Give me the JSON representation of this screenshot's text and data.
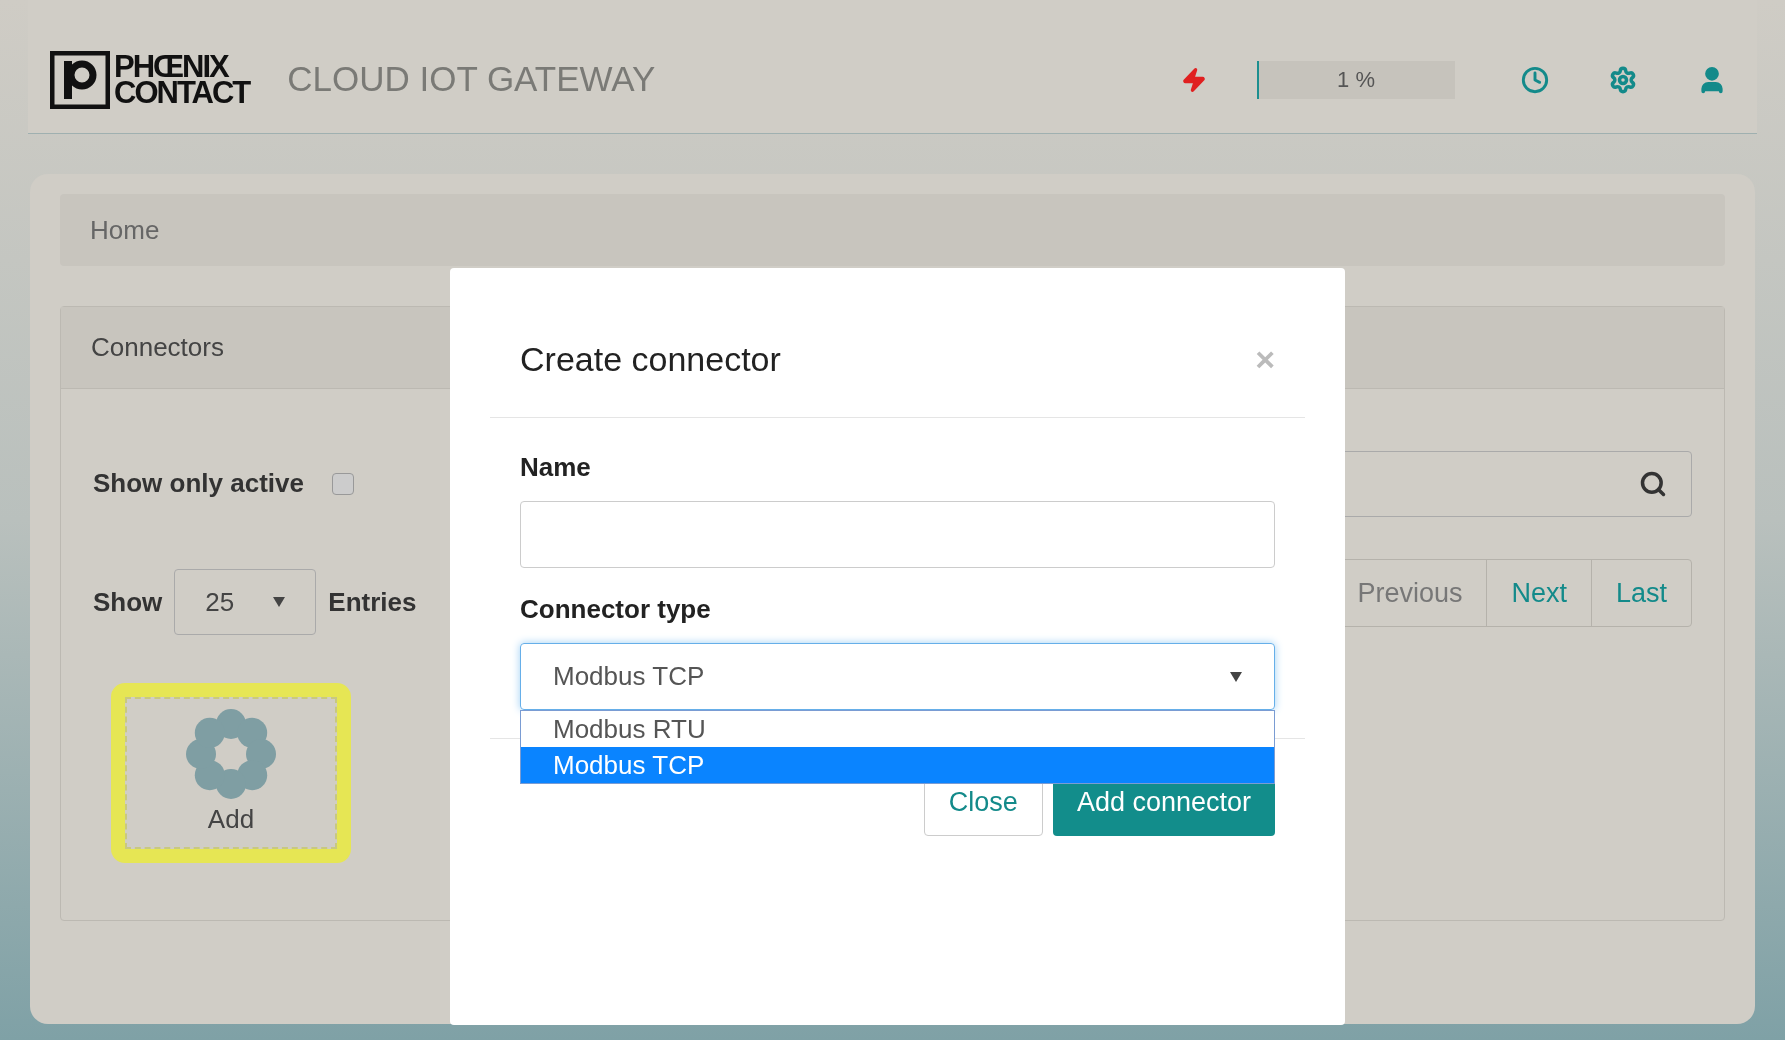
{
  "header": {
    "logo": [
      "PHŒNIX",
      "CONTACT"
    ],
    "title": "CLOUD IOT GATEWAY",
    "usage": {
      "level": 0.01,
      "reading": "1 %"
    }
  },
  "breadcrumb": "Home",
  "panel": {
    "title": "Connectors",
    "filter": {
      "label": "Show only active",
      "checked": false
    },
    "page_size": {
      "label_before": "Show",
      "value": "25",
      "label_after": "Entries"
    },
    "add_tile": {
      "label": "Add",
      "highlighted": true
    },
    "pagination": [
      {
        "label": "Previous",
        "disabled": true
      },
      {
        "label": "Next",
        "disabled": false
      },
      {
        "label": "Last",
        "disabled": false
      }
    ]
  },
  "modal": {
    "title": "Create connector",
    "close": "×",
    "fields": [
      {
        "label": "Name",
        "kind": "text"
      },
      {
        "label": "Connector type",
        "kind": "select",
        "value": "Modbus TCP",
        "open": true,
        "options": [
          {
            "label": "Modbus RTU",
            "selected": false
          },
          {
            "label": "Modbus TCP",
            "selected": true
          }
        ]
      }
    ],
    "buttons": [
      {
        "label": "Close",
        "kind": "secondary"
      },
      {
        "label": "Add connector",
        "kind": "primary"
      }
    ]
  }
}
